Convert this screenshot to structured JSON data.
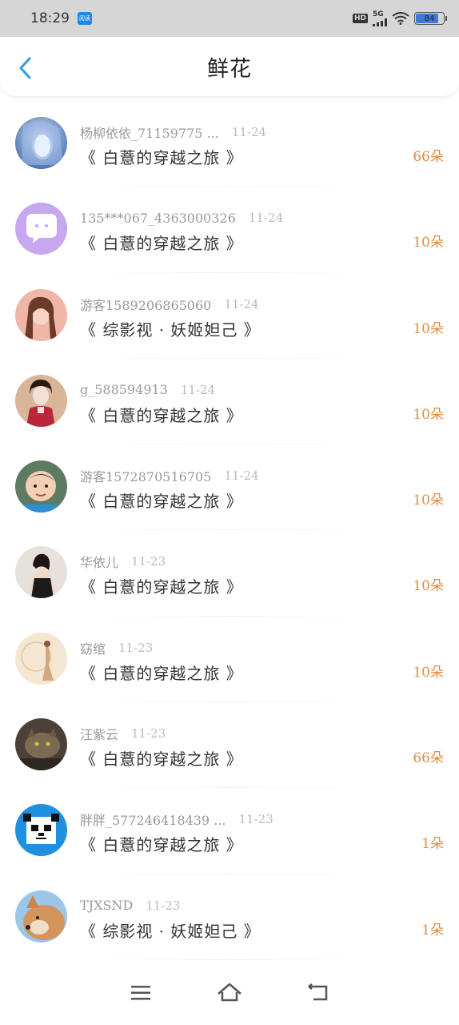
{
  "status_bar": {
    "time": "18:29",
    "app_badge": "阅读",
    "hd": "HD",
    "network": "5G",
    "battery": "84",
    "battery_level": 0.84
  },
  "header": {
    "title": "鲜花"
  },
  "items": [
    {
      "user": "杨柳依依_71159775 ...",
      "date": "11-24",
      "book": "《 白薏的穿越之旅 》",
      "count": "66朵",
      "avatar": "avatar-1"
    },
    {
      "user": "135***067_4363000326",
      "date": "11-24",
      "book": "《 白薏的穿越之旅 》",
      "count": "10朵",
      "avatar": "avatar-2"
    },
    {
      "user": "游客1589206865060",
      "date": "11-24",
      "book": "《 综影视 · 妖姬妲己 》",
      "count": "10朵",
      "avatar": "avatar-3"
    },
    {
      "user": "g_588594913",
      "date": "11-24",
      "book": "《 白薏的穿越之旅 》",
      "count": "10朵",
      "avatar": "avatar-4"
    },
    {
      "user": "游客1572870516705",
      "date": "11-24",
      "book": "《 白薏的穿越之旅 》",
      "count": "10朵",
      "avatar": "avatar-5"
    },
    {
      "user": "华依儿",
      "date": "11-23",
      "book": "《 白薏的穿越之旅 》",
      "count": "10朵",
      "avatar": "avatar-6"
    },
    {
      "user": "窈绾",
      "date": "11-23",
      "book": "《 白薏的穿越之旅 》",
      "count": "10朵",
      "avatar": "avatar-7"
    },
    {
      "user": "汪紫云",
      "date": "11-23",
      "book": "《 白薏的穿越之旅 》",
      "count": "66朵",
      "avatar": "avatar-8"
    },
    {
      "user": "胖胖_577246418439 ...",
      "date": "11-23",
      "book": "《 白薏的穿越之旅 》",
      "count": "1朵",
      "avatar": "avatar-9"
    },
    {
      "user": "TJXSND",
      "date": "11-23",
      "book": "《 综影视 · 妖姬妲己 》",
      "count": "1朵",
      "avatar": "avatar-10"
    }
  ],
  "colors": {
    "accent_blue": "#2f9be6",
    "count_orange": "#e38b3f"
  }
}
